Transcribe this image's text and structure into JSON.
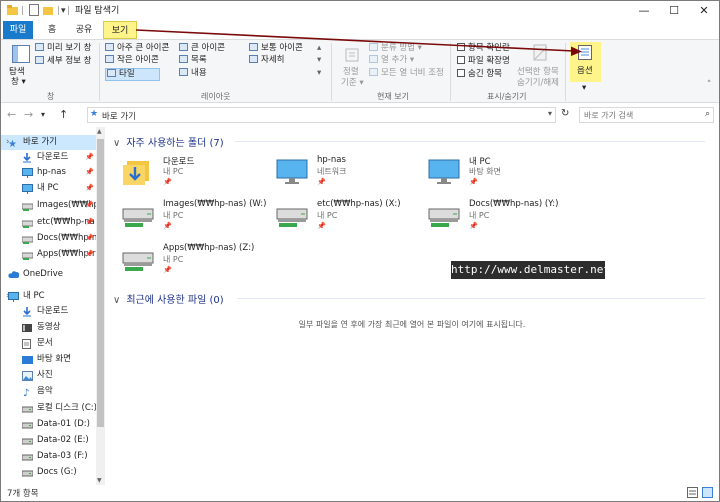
{
  "window": {
    "title": "파일 탐색기",
    "min_glyph": "—",
    "max_glyph": "☐",
    "close_glyph": "✕"
  },
  "ribbon_tabs": [
    "파일",
    "홈",
    "공유",
    "보기"
  ],
  "ribbon": {
    "pane_group": {
      "label": "창",
      "nav_pane": "탐색",
      "nav_pane2": "창 ▾",
      "preview": "미리 보기 창",
      "details": "세부 정보 창"
    },
    "layout_group": {
      "label": "레이아웃",
      "items": [
        "아주 큰 아이콘",
        "큰 아이콘",
        "보통 아이콘",
        "작은 아이콘",
        "목록",
        "자세히",
        "타일",
        "내용"
      ]
    },
    "current_view_group": {
      "label": "현재 보기",
      "sort": "정렬",
      "sort2": "기준 ▾",
      "group_by": "분류 방법 ▾",
      "add_column": "열 추가 ▾",
      "fit_columns": "모든 열 너비 조정"
    },
    "show_hide_group": {
      "label": "표시/숨기기",
      "checkboxes": [
        "항목 확인란",
        "파일 확장명",
        "숨긴 항목"
      ],
      "hide_selected": "선택한 항목",
      "hide_selected2": "숨기기/해제"
    },
    "options": {
      "label": "옵션",
      "caret": "▾"
    }
  },
  "address": {
    "path": "바로 가기",
    "search_placeholder": "바로 가기 검색"
  },
  "nav": {
    "items": [
      {
        "label": "바로 가기",
        "icon": "star-icon",
        "pinned": false,
        "selected": true
      },
      {
        "label": "다운로드",
        "icon": "download-icon",
        "pinned": true
      },
      {
        "label": "hp-nas",
        "icon": "monitor-icon",
        "pinned": true
      },
      {
        "label": "내 PC",
        "icon": "monitor-icon",
        "pinned": true
      },
      {
        "label": "Images(₩₩hp",
        "icon": "drive-icon",
        "pinned": true
      },
      {
        "label": "etc(₩₩hp-na",
        "icon": "drive-icon",
        "pinned": true
      },
      {
        "label": "Docs(₩₩hp-n",
        "icon": "drive-icon",
        "pinned": true
      },
      {
        "label": "Apps(₩₩hp-r",
        "icon": "drive-icon",
        "pinned": true
      },
      {
        "label": "OneDrive",
        "icon": "cloud-icon",
        "pinned": false
      },
      {
        "label": "내 PC",
        "icon": "monitor-icon",
        "pinned": false
      },
      {
        "label": "다운로드",
        "icon": "download-icon",
        "pinned": false
      },
      {
        "label": "동영상",
        "icon": "video-icon",
        "pinned": false
      },
      {
        "label": "문서",
        "icon": "document-icon",
        "pinned": false
      },
      {
        "label": "바탕 화면",
        "icon": "desktop-icon",
        "pinned": false
      },
      {
        "label": "사진",
        "icon": "picture-icon",
        "pinned": false
      },
      {
        "label": "음악",
        "icon": "music-icon",
        "pinned": false
      },
      {
        "label": "로컬 디스크 (C:)",
        "icon": "disk-icon",
        "pinned": false
      },
      {
        "label": "Data-01 (D:)",
        "icon": "disk-icon",
        "pinned": false
      },
      {
        "label": "Data-02 (E:)",
        "icon": "disk-icon",
        "pinned": false
      },
      {
        "label": "Data-03 (F:)",
        "icon": "disk-icon",
        "pinned": false
      },
      {
        "label": "Docs (G:)",
        "icon": "disk-icon",
        "pinned": false
      }
    ]
  },
  "content": {
    "frequent_header": "자주 사용하는 폴더 (7)",
    "recent_header": "최근에 사용한 파일 (0)",
    "recent_empty": "일부 파일을 연 후에 가장 최근에 열어 본 파일이 여기에 표시됩니다.",
    "folders": [
      {
        "name": "다운로드",
        "sub": "내 PC",
        "icon": "download-folder-icon"
      },
      {
        "name": "hp-nas",
        "sub": "네트워크",
        "icon": "monitor-icon"
      },
      {
        "name": "내 PC",
        "sub": "바탕 화면",
        "icon": "monitor-icon"
      },
      {
        "name": "Images(₩₩hp-nas) (W:)",
        "sub": "내 PC",
        "icon": "network-drive-icon"
      },
      {
        "name": "etc(₩₩hp-nas) (X:)",
        "sub": "내 PC",
        "icon": "network-drive-icon"
      },
      {
        "name": "Docs(₩₩hp-nas) (Y:)",
        "sub": "내 PC",
        "icon": "network-drive-icon"
      },
      {
        "name": "Apps(₩₩hp-nas) (Z:)",
        "sub": "내 PC",
        "icon": "network-drive-icon"
      }
    ]
  },
  "watermark": "http://www.delmaster.net",
  "status": {
    "count": "7개 항목"
  },
  "colors": {
    "accent": "#1979ca",
    "highlight": "#fff48a",
    "arrow": "#8b0000"
  }
}
